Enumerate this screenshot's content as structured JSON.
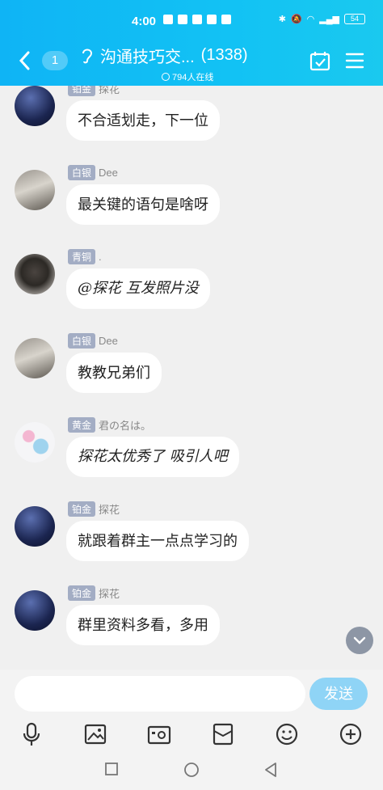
{
  "status": {
    "time": "4:00",
    "battery": "54"
  },
  "header": {
    "unread": "1",
    "title": "沟通技巧交...",
    "member_count": "(1338)",
    "online": "794人在线"
  },
  "messages": [
    {
      "badge": "铂金",
      "name": "探花",
      "text": "不合适划走，下一位",
      "avatar": "night-sky"
    },
    {
      "badge": "白银",
      "name": "Dee",
      "text": "最关键的语句是啥呀",
      "avatar": "photo"
    },
    {
      "badge": "青铜",
      "name": ".",
      "text": "@探花 互发照片没",
      "avatar": "figure"
    },
    {
      "badge": "白银",
      "name": "Dee",
      "text": "教教兄弟们",
      "avatar": "photo"
    },
    {
      "badge": "黄金",
      "name": "君の名は。",
      "text": "探花太优秀了 吸引人吧",
      "avatar": "pattern"
    },
    {
      "badge": "铂金",
      "name": "探花",
      "text": "就跟着群主一点点学习的",
      "avatar": "night-sky"
    },
    {
      "badge": "铂金",
      "name": "探花",
      "text": "群里资料多看，多用",
      "avatar": "night-sky"
    }
  ],
  "input": {
    "placeholder": "",
    "send_label": "发送"
  },
  "colors": {
    "header": "#12bdf4",
    "badge": "#a3adc4",
    "send": "#8fd4f6"
  }
}
